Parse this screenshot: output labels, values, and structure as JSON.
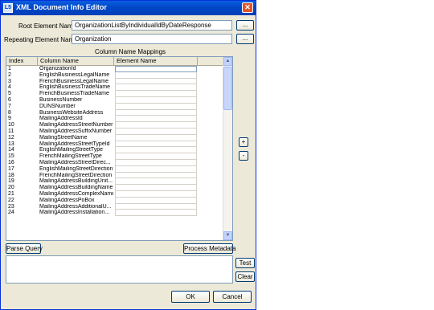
{
  "window": {
    "title": "XML Document Info Editor",
    "icon_text": "L5",
    "close_glyph": "✕"
  },
  "root_element": {
    "label": "Root Element Name:",
    "value": "OrganizationListByIndividualIdByDateResponse",
    "browse_label": "..."
  },
  "repeating_element": {
    "label": "Repeating Element Name:",
    "value": "Organization",
    "browse_label": "..."
  },
  "mappings": {
    "section_label": "Column Name Mappings",
    "headers": {
      "index": "Index",
      "column": "Column Name",
      "element": "Element Name"
    },
    "rows": [
      {
        "index": "1",
        "column": "OrganizationId",
        "element": ""
      },
      {
        "index": "2",
        "column": "EnglishBusinessLegalName",
        "element": ""
      },
      {
        "index": "3",
        "column": "FrenchBusinessLegalName",
        "element": ""
      },
      {
        "index": "4",
        "column": "EnglishBusinessTradeName",
        "element": ""
      },
      {
        "index": "5",
        "column": "FrenchBusinessTradeName",
        "element": ""
      },
      {
        "index": "6",
        "column": "BusinessNumber",
        "element": ""
      },
      {
        "index": "7",
        "column": "DUNSNumber",
        "element": ""
      },
      {
        "index": "8",
        "column": "BusinessWebsiteAddress",
        "element": ""
      },
      {
        "index": "9",
        "column": "MailingAddressId",
        "element": ""
      },
      {
        "index": "10",
        "column": "MailingAddressStreetNumber",
        "element": ""
      },
      {
        "index": "11",
        "column": "MailingAddressSuffixNumber",
        "element": ""
      },
      {
        "index": "12",
        "column": "MailingStreetName",
        "element": ""
      },
      {
        "index": "13",
        "column": "MailingAddressStreetTypeId",
        "element": ""
      },
      {
        "index": "14",
        "column": "EnglishMailingStreetType",
        "element": ""
      },
      {
        "index": "15",
        "column": "FrenchMailingStreetType",
        "element": ""
      },
      {
        "index": "16",
        "column": "MailingAddressStreetDirec...",
        "element": ""
      },
      {
        "index": "17",
        "column": "EnglishMailingStreetDirection",
        "element": ""
      },
      {
        "index": "18",
        "column": "FrenchMailingStreetDirection",
        "element": ""
      },
      {
        "index": "19",
        "column": "MailingAddressBuildingUnit...",
        "element": ""
      },
      {
        "index": "20",
        "column": "MailingAddressBuildingName",
        "element": ""
      },
      {
        "index": "21",
        "column": "MailingAddressComplexName",
        "element": ""
      },
      {
        "index": "22",
        "column": "MailingAddressPoBox",
        "element": ""
      },
      {
        "index": "23",
        "column": "MailingAddressAdditionalU...",
        "element": ""
      },
      {
        "index": "24",
        "column": "MailingAddressInstallation...",
        "element": ""
      }
    ],
    "scroll_up": "▲",
    "scroll_down": "▼"
  },
  "side_buttons": {
    "add": "+",
    "remove": "-"
  },
  "parse_query_label": "Parse Query",
  "process_metadata_label": "Process Metadata",
  "query_text": "",
  "test_label": "Test",
  "clear_label": "Clear",
  "ok_label": "OK",
  "cancel_label": "Cancel",
  "colors": {
    "titlebar": "#0047c9",
    "dialog_bg": "#ece9d8",
    "close": "#e0532e"
  }
}
